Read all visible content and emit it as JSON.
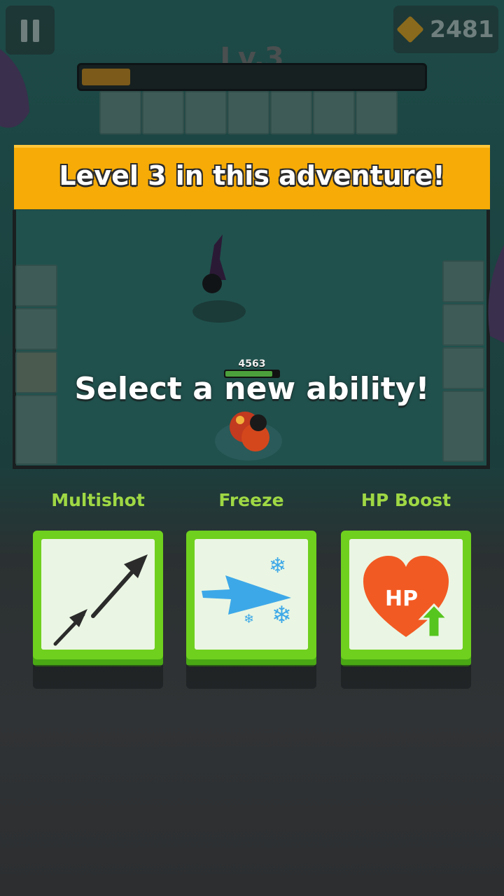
{
  "hud": {
    "gems": "2481",
    "level_label": "Lv.3",
    "xp_progress": 0.14
  },
  "banner": {
    "text": "Level 3 in this adventure!"
  },
  "hero": {
    "hp_value": "4563",
    "hp_fraction": 0.88
  },
  "prompt": {
    "text": "Select a new ability!"
  },
  "abilities": [
    {
      "label": "Multishot",
      "icon": "multishot-arrows-icon"
    },
    {
      "label": "Freeze",
      "icon": "freeze-arrow-icon"
    },
    {
      "label": "HP Boost",
      "icon": "hp-boost-heart-icon",
      "badge": "HP"
    }
  ],
  "colors": {
    "banner": "#f6ab06",
    "card": "#6fd01e",
    "label": "#9fd844"
  }
}
